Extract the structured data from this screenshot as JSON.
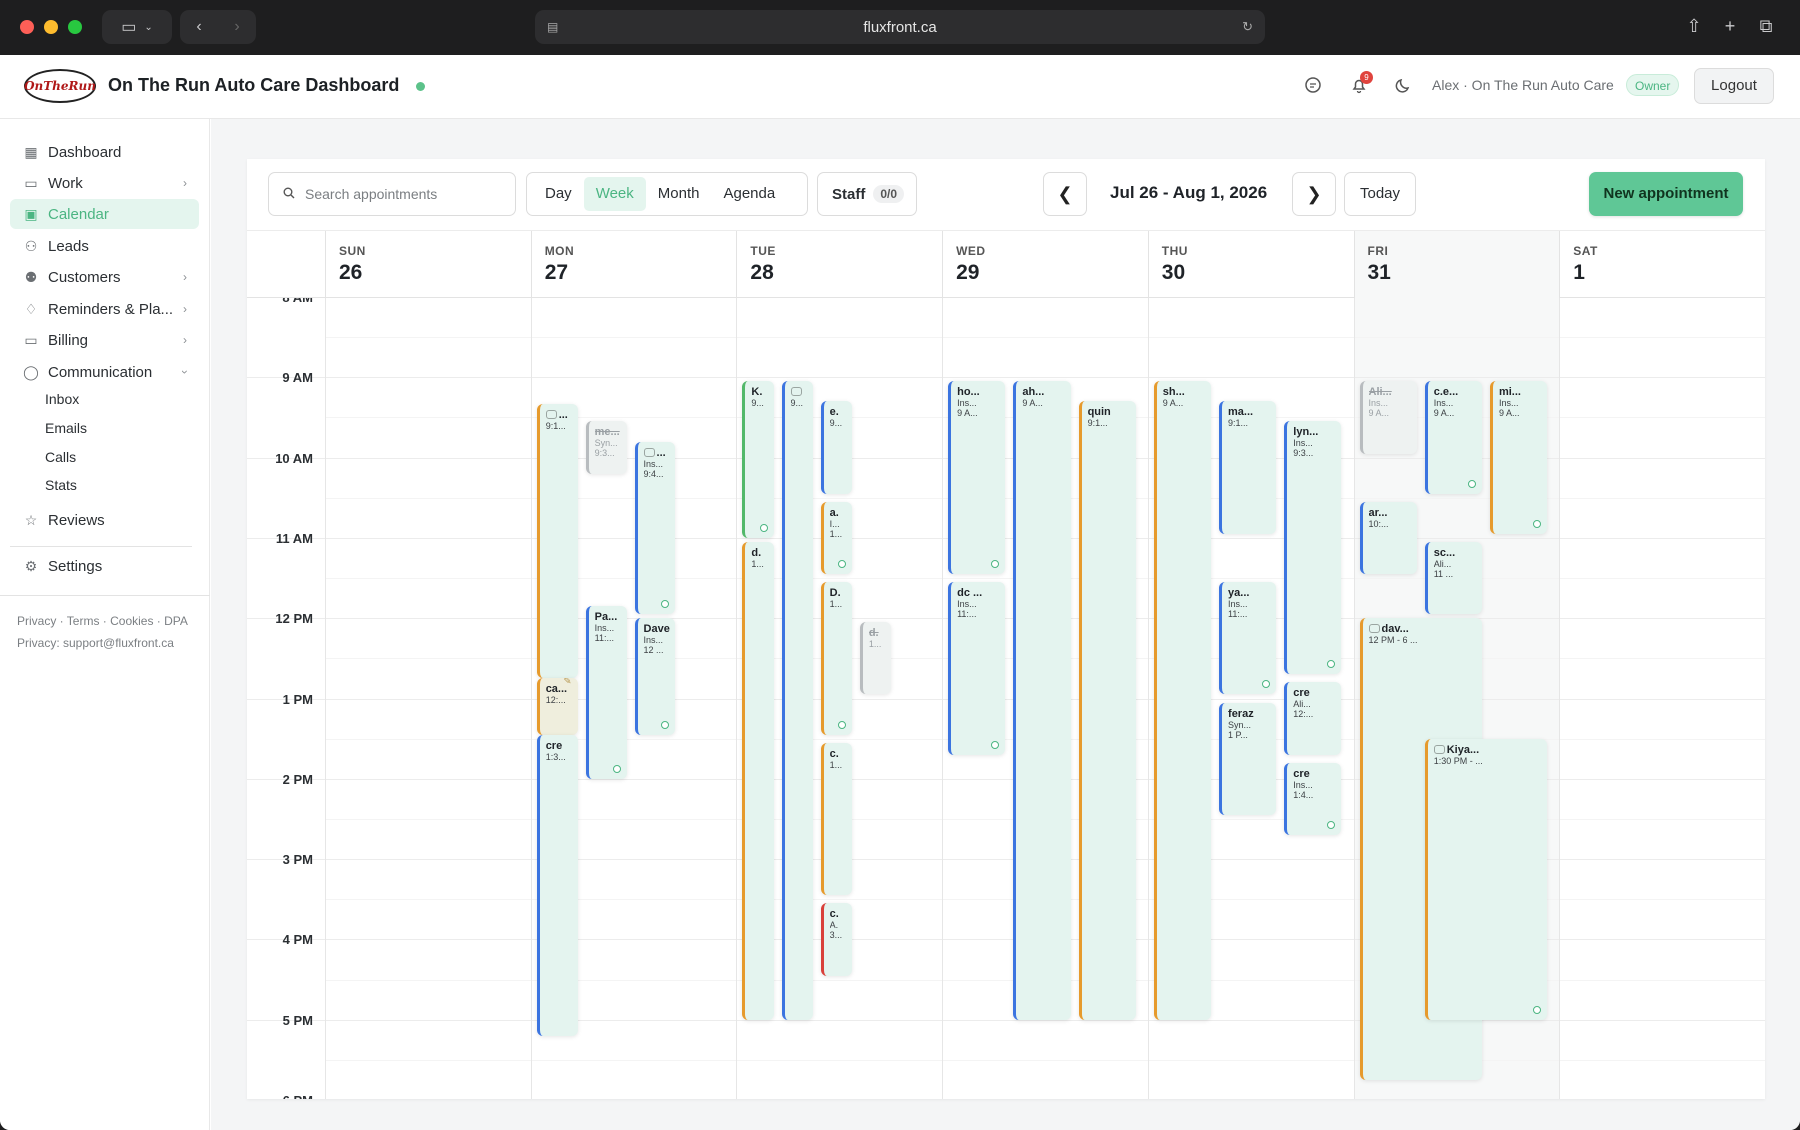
{
  "browser": {
    "url": "fluxfront.ca"
  },
  "header": {
    "logo_text": "OnTheRun",
    "title": "On The Run Auto Care Dashboard",
    "notification_count": "9",
    "user_label": "Alex · On The Run Auto Care",
    "role_badge": "Owner",
    "logout_label": "Logout"
  },
  "sidebar": {
    "items": [
      {
        "label": "Dashboard",
        "icon": "grid-icon"
      },
      {
        "label": "Work",
        "icon": "briefcase-icon"
      },
      {
        "label": "Calendar",
        "icon": "calendar-icon"
      },
      {
        "label": "Leads",
        "icon": "user-plus-icon"
      },
      {
        "label": "Customers",
        "icon": "users-icon"
      },
      {
        "label": "Reminders & Pla...",
        "icon": "bell-icon"
      },
      {
        "label": "Billing",
        "icon": "credit-card-icon"
      },
      {
        "label": "Communication",
        "icon": "chat-icon"
      }
    ],
    "communication_sub": [
      "Inbox",
      "Emails",
      "Calls",
      "Stats"
    ],
    "reviews": "Reviews",
    "settings": "Settings",
    "footer_links": "Privacy · Terms · Cookies · DPA",
    "footer_contact": "Privacy: support@fluxfront.ca"
  },
  "toolbar": {
    "search_placeholder": "Search appointments",
    "views": [
      "Day",
      "Week",
      "Month",
      "Agenda"
    ],
    "active_view": "Week",
    "staff_label": "Staff",
    "staff_count": "0/0",
    "prev": "❮",
    "next": "❯",
    "date_range": "Jul 26 - Aug 1, 2026",
    "today_label": "Today",
    "new_label": "New appointment"
  },
  "days": [
    {
      "name": "SUN",
      "date": "26"
    },
    {
      "name": "MON",
      "date": "27"
    },
    {
      "name": "TUE",
      "date": "28"
    },
    {
      "name": "WED",
      "date": "29"
    },
    {
      "name": "THU",
      "date": "30"
    },
    {
      "name": "FRI",
      "date": "31"
    },
    {
      "name": "SAT",
      "date": "1"
    }
  ],
  "today_index": 5,
  "time_labels": [
    "8 AM",
    "9 AM",
    "10 AM",
    "11 AM",
    "12 PM",
    "1 PM",
    "2 PM",
    "3 PM",
    "4 PM",
    "5 PM",
    "6 PM"
  ],
  "event_colors": {
    "blue": "#3b74e0",
    "orange": "#e69a2c",
    "green": "#52b86a",
    "red": "#d9403a",
    "gray": "#b8bcbf",
    "event_bg": "#e4f4ef"
  },
  "events": [
    {
      "day": 1,
      "slot": 0,
      "slots": 4,
      "start": 9.33,
      "end": 12.75,
      "color": "orange",
      "chat": true,
      "title": "...",
      "lines": [
        "9:1..."
      ]
    },
    {
      "day": 1,
      "slot": 0,
      "slots": 4,
      "start": 12.75,
      "end": 13.45,
      "color": "orange",
      "beige": true,
      "note": true,
      "title": "ca...",
      "lines": [
        "12:..."
      ]
    },
    {
      "day": 1,
      "slot": 0,
      "slots": 4,
      "start": 13.45,
      "end": 17.2,
      "color": "blue",
      "title": "cre",
      "lines": [
        "1:3..."
      ]
    },
    {
      "day": 1,
      "slot": 1,
      "slots": 4,
      "start": 9.55,
      "end": 10.2,
      "color": "gray",
      "strike": true,
      "title": "me...",
      "lines": [
        "Syn...",
        "9:3..."
      ]
    },
    {
      "day": 1,
      "slot": 1,
      "slots": 4,
      "start": 11.85,
      "end": 14.0,
      "color": "blue",
      "status": true,
      "title": "Pa...",
      "lines": [
        "Ins...",
        "11:..."
      ]
    },
    {
      "day": 1,
      "slot": 2,
      "slots": 4,
      "start": 9.8,
      "end": 11.95,
      "color": "blue",
      "chat": true,
      "status": true,
      "title": "...",
      "lines": [
        "Ins...",
        "9:4..."
      ]
    },
    {
      "day": 1,
      "slot": 2,
      "slots": 4,
      "start": 12.0,
      "end": 13.45,
      "color": "blue",
      "status": true,
      "title": "Dave",
      "lines": [
        "Ins...",
        "12 ..."
      ]
    },
    {
      "day": 2,
      "slot": 0,
      "slots": 5,
      "start": 9.05,
      "end": 11.0,
      "color": "green",
      "status": true,
      "title": "K.",
      "lines": [
        "9..."
      ]
    },
    {
      "day": 2,
      "slot": 0,
      "slots": 5,
      "start": 11.05,
      "end": 17.0,
      "color": "orange",
      "title": "d.",
      "lines": [
        "1..."
      ]
    },
    {
      "day": 2,
      "slot": 1,
      "slots": 5,
      "start": 9.05,
      "end": 17.0,
      "color": "blue",
      "chat": true,
      "title": "",
      "lines": [
        "9..."
      ]
    },
    {
      "day": 2,
      "slot": 2,
      "slots": 5,
      "start": 9.3,
      "end": 10.45,
      "color": "blue",
      "title": "e.",
      "lines": [
        "9..."
      ]
    },
    {
      "day": 2,
      "slot": 2,
      "slots": 5,
      "start": 10.55,
      "end": 11.45,
      "color": "orange",
      "status": true,
      "title": "a.",
      "lines": [
        "I...",
        "1..."
      ]
    },
    {
      "day": 2,
      "slot": 2,
      "slots": 5,
      "start": 11.55,
      "end": 13.45,
      "color": "orange",
      "status": true,
      "title": "D.",
      "lines": [
        "1..."
      ]
    },
    {
      "day": 2,
      "slot": 2,
      "slots": 5,
      "start": 13.55,
      "end": 15.45,
      "color": "orange",
      "title": "c.",
      "lines": [
        "1..."
      ]
    },
    {
      "day": 2,
      "slot": 2,
      "slots": 5,
      "start": 15.55,
      "end": 16.45,
      "color": "red",
      "title": "c.",
      "lines": [
        "A.",
        "3..."
      ]
    },
    {
      "day": 2,
      "slot": 3,
      "slots": 5,
      "start": 12.05,
      "end": 12.95,
      "color": "gray",
      "strike": true,
      "title": "d.",
      "lines": [
        "1..."
      ]
    },
    {
      "day": 3,
      "slot": 0,
      "slots": 3,
      "start": 9.05,
      "end": 11.45,
      "color": "blue",
      "status": true,
      "title": "ho...",
      "lines": [
        "Ins...",
        "9 A..."
      ]
    },
    {
      "day": 3,
      "slot": 0,
      "slots": 3,
      "start": 11.55,
      "end": 13.7,
      "color": "blue",
      "status": true,
      "title": "dc ...",
      "lines": [
        "Ins...",
        "11:..."
      ]
    },
    {
      "day": 3,
      "slot": 1,
      "slots": 3,
      "start": 9.05,
      "end": 17.0,
      "color": "blue",
      "title": "ah...",
      "lines": [
        "9 A..."
      ]
    },
    {
      "day": 3,
      "slot": 2,
      "slots": 3,
      "start": 9.3,
      "end": 17.0,
      "color": "orange",
      "title": "quin",
      "lines": [
        "9:1..."
      ]
    },
    {
      "day": 4,
      "slot": 0,
      "slots": 3,
      "start": 9.05,
      "end": 17.0,
      "color": "orange",
      "title": "sh...",
      "lines": [
        "9 A..."
      ]
    },
    {
      "day": 4,
      "slot": 1,
      "slots": 3,
      "start": 9.3,
      "end": 10.95,
      "color": "blue",
      "title": "ma...",
      "lines": [
        "9:1..."
      ]
    },
    {
      "day": 4,
      "slot": 1,
      "slots": 3,
      "start": 11.55,
      "end": 12.95,
      "color": "blue",
      "status": true,
      "title": "ya...",
      "lines": [
        "Ins...",
        "11:..."
      ]
    },
    {
      "day": 4,
      "slot": 1,
      "slots": 3,
      "start": 13.05,
      "end": 14.45,
      "color": "blue",
      "title": "feraz",
      "lines": [
        "Syn...",
        "1 P..."
      ]
    },
    {
      "day": 4,
      "slot": 2,
      "slots": 3,
      "start": 9.55,
      "end": 12.7,
      "color": "blue",
      "status": true,
      "title": "lyn...",
      "lines": [
        "Ins...",
        "9:3..."
      ]
    },
    {
      "day": 4,
      "slot": 2,
      "slots": 3,
      "start": 12.8,
      "end": 13.7,
      "color": "blue",
      "title": "cre",
      "lines": [
        "Ali...",
        "12:..."
      ]
    },
    {
      "day": 4,
      "slot": 2,
      "slots": 3,
      "start": 13.8,
      "end": 14.7,
      "color": "blue",
      "status": true,
      "title": "cre",
      "lines": [
        "Ins...",
        "1:4..."
      ]
    },
    {
      "day": 5,
      "slot": 0,
      "slots": 3,
      "start": 9.05,
      "end": 9.95,
      "color": "gray",
      "strike": true,
      "title": "Ali...",
      "lines": [
        "Ins...",
        "9 A..."
      ]
    },
    {
      "day": 5,
      "slot": 0,
      "slots": 3,
      "start": 10.55,
      "end": 11.45,
      "color": "blue",
      "title": "ar...",
      "lines": [
        "10:..."
      ]
    },
    {
      "day": 5,
      "slot": 0,
      "slots": 3,
      "start": 12.0,
      "end": 17.75,
      "color": "orange",
      "wide": 2,
      "chat": true,
      "title": "dav...",
      "lines": [
        "12 PM - 6 ..."
      ]
    },
    {
      "day": 5,
      "slot": 1,
      "slots": 3,
      "start": 9.05,
      "end": 10.45,
      "color": "blue",
      "status": true,
      "title": "c.e...",
      "lines": [
        "Ins...",
        "9 A..."
      ]
    },
    {
      "day": 5,
      "slot": 1,
      "slots": 3,
      "start": 11.05,
      "end": 11.95,
      "color": "blue",
      "title": "sc...",
      "lines": [
        "Ali...",
        "11 ..."
      ]
    },
    {
      "day": 5,
      "slot": 1,
      "slots": 3,
      "start": 13.5,
      "end": 17.0,
      "color": "orange",
      "wide": 2,
      "chat": true,
      "status": true,
      "title": "Kiya...",
      "lines": [
        "1:30 PM - ..."
      ]
    },
    {
      "day": 5,
      "slot": 2,
      "slots": 3,
      "start": 9.05,
      "end": 10.95,
      "color": "orange",
      "status": true,
      "title": "mi...",
      "lines": [
        "Ins...",
        "9 A..."
      ]
    }
  ]
}
